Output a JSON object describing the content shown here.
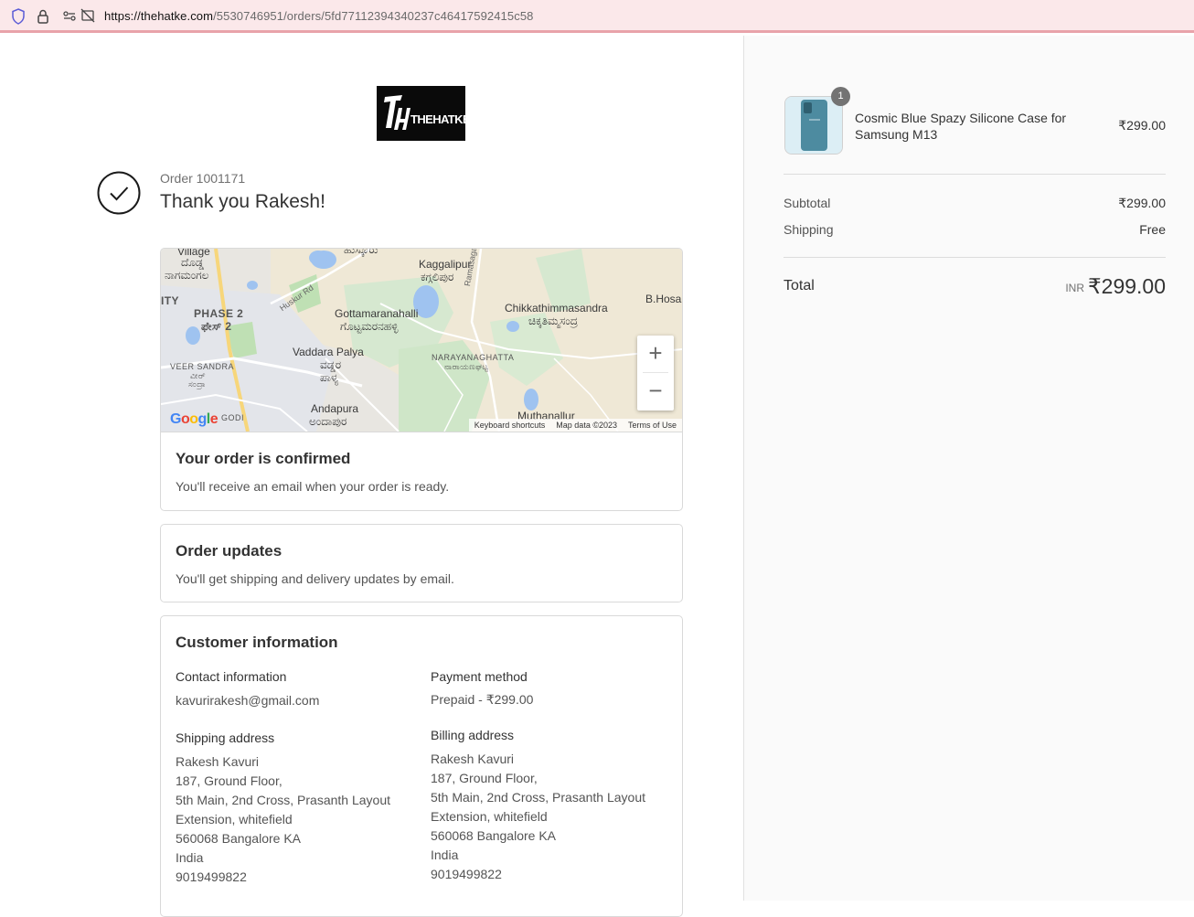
{
  "browser": {
    "url_host": "https://thehatke.com",
    "url_path": "/5530746951/orders/5fd77112394340237c46417592415c58"
  },
  "brand": {
    "logo_text": "THEHATKE",
    "logo_monogram": "TH"
  },
  "header": {
    "order_number": "Order 1001171",
    "thank_you": "Thank you Rakesh!"
  },
  "map": {
    "labels": {
      "village": "Village",
      "doddha": "ದೊಡ್ಡ",
      "nagamangala": "ನಾಗಮಂಗಲ",
      "husuru": "ಹುಸ್ಕೂರು",
      "kaggalipur": "Kaggalipur",
      "kaggalipur_kn": "ಕಗ್ಗಲಿಪುರ",
      "ramasagara_rd": "Ramasagara Rd",
      "huskur_rd": "Huskur Rd",
      "ity": "ITY",
      "phase2": "PHASE 2",
      "phase2_kn": "ಫೇಸ್ 2",
      "gottamaranahalli": "Gottamaranahalli",
      "gottamaranahalli_kn": "ಗೊಟ್ಟಮರನಹಳ್ಳಿ",
      "chikkathimmasandra": "Chikkathimmasandra",
      "chikkathimmasandra_kn": "ಚಿಕ್ಕತಿಮ್ಮಸಂದ್ರ",
      "bhosa": "B.Hosa",
      "vaddara_palya": "Vaddara Palya",
      "vaddara_palya_kn1": "ವಡ್ಡರ",
      "vaddara_palya_kn2": "ಪಾಳ್ಯ",
      "veer_sandra": "VEER SANDRA",
      "veer_kn1": "ವೀರ್",
      "veer_kn2": "ಸಂದ್ರಾ",
      "narayanaghatta": "NARAYANAGHATTA",
      "narayanaghatta_kn": "ನಾರಾಯಣಘಟ್ಟ",
      "andapura": "Andapura",
      "andapura_kn": "ಅಂದಾಪುರ",
      "muthanallur": "Muthanallur",
      "godi": "GODI"
    },
    "google": "Google",
    "keyboard_shortcuts": "Keyboard shortcuts",
    "map_data": "Map data ©2023",
    "terms": "Terms of Use",
    "zoom_in": "+",
    "zoom_out": "−"
  },
  "confirmed": {
    "title": "Your order is confirmed",
    "text": "You'll receive an email when your order is ready."
  },
  "updates": {
    "title": "Order updates",
    "text": "You'll get shipping and delivery updates by email."
  },
  "customer": {
    "title": "Customer information",
    "contact_label": "Contact information",
    "contact_value": "kavurirakesh@gmail.com",
    "payment_label": "Payment method",
    "payment_value": "Prepaid - ₹299.00",
    "shipping_label": "Shipping address",
    "shipping_lines": [
      "Rakesh Kavuri",
      "187, Ground Floor,",
      "5th Main, 2nd Cross, Prasanth Layout",
      "Extension, whitefield",
      "560068 Bangalore KA",
      "India",
      "9019499822"
    ],
    "billing_label": "Billing address",
    "billing_lines": [
      "Rakesh Kavuri",
      "187, Ground Floor,",
      "5th Main, 2nd Cross, Prasanth Layout",
      "Extension, whitefield",
      "560068 Bangalore KA",
      "India",
      "9019499822"
    ]
  },
  "summary": {
    "item": {
      "quantity": "1",
      "name": "Cosmic Blue Spazy Silicone Case for Samsung M13",
      "price": "₹299.00"
    },
    "subtotal_label": "Subtotal",
    "subtotal_value": "₹299.00",
    "shipping_label": "Shipping",
    "shipping_value": "Free",
    "total_label": "Total",
    "currency": "INR",
    "total_value": "₹299.00"
  }
}
